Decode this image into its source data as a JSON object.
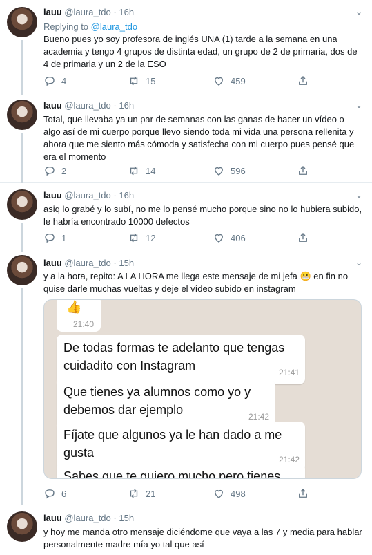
{
  "tweets": [
    {
      "name": "lauu",
      "handle": "@laura_tdo",
      "dot": "·",
      "time": "16h",
      "replying_prefix": "Replying to",
      "replying_handle": "@laura_tdo",
      "text": "Bueno pues yo soy profesora de inglés UNA (1) tarde a la semana en una academia y tengo 4 grupos de distinta edad, un grupo de 2 de primaria, dos de 4 de primaria y un 2 de la ESO",
      "replies": "4",
      "retweets": "15",
      "likes": "459"
    },
    {
      "name": "lauu",
      "handle": "@laura_tdo",
      "dot": "·",
      "time": "16h",
      "text": "Total, que llevaba ya un par de semanas con las ganas de hacer un vídeo o algo así de mi cuerpo porque llevo siendo toda mi vida una persona rellenita y ahora que me siento más cómoda y satisfecha con mi cuerpo pues pensé que era el momento",
      "replies": "2",
      "retweets": "14",
      "likes": "596"
    },
    {
      "name": "lauu",
      "handle": "@laura_tdo",
      "dot": "·",
      "time": "16h",
      "text": "asiq lo grabé y lo subí, no me lo pensé mucho porque sino no lo hubiera subido, le habría encontrado 10000 defectos",
      "replies": "1",
      "retweets": "12",
      "likes": "406"
    },
    {
      "name": "lauu",
      "handle": "@laura_tdo",
      "dot": "·",
      "time": "15h",
      "text_before": "y a la hora, repito: A LA HORA me llega este mensaje de mi jefa",
      "emoji": "😬",
      "text_after": " en fin no quise darle muchas vueltas y deje el vídeo subido en instagram",
      "replies": "6",
      "retweets": "21",
      "likes": "498",
      "chat": {
        "first_time": "21:40",
        "messages": [
          {
            "text": "De todas formas te adelanto que tengas cuidadito con Instagram",
            "time": "21:41"
          },
          {
            "text": "Que tienes ya alumnos como yo y debemos dar ejemplo",
            "time": "21:42"
          },
          {
            "text": "Fíjate que algunos ya le han dado a me gusta",
            "time": "21:42"
          },
          {
            "text": "Sabes que te quiero mucho pero tienes",
            "time": ""
          }
        ]
      }
    },
    {
      "name": "lauu",
      "handle": "@laura_tdo",
      "dot": "·",
      "time": "15h",
      "text": "y hoy me manda otro mensaje diciéndome que vaya a las 7 y media para hablar personalmente madre mía yo tal que así"
    }
  ],
  "colors": {
    "link": "#1b95e0",
    "muted": "#657786",
    "chat_bg": "#e5ddd5"
  },
  "icons": [
    "reply-icon",
    "retweet-icon",
    "like-icon",
    "share-icon",
    "chevron-down-icon"
  ]
}
